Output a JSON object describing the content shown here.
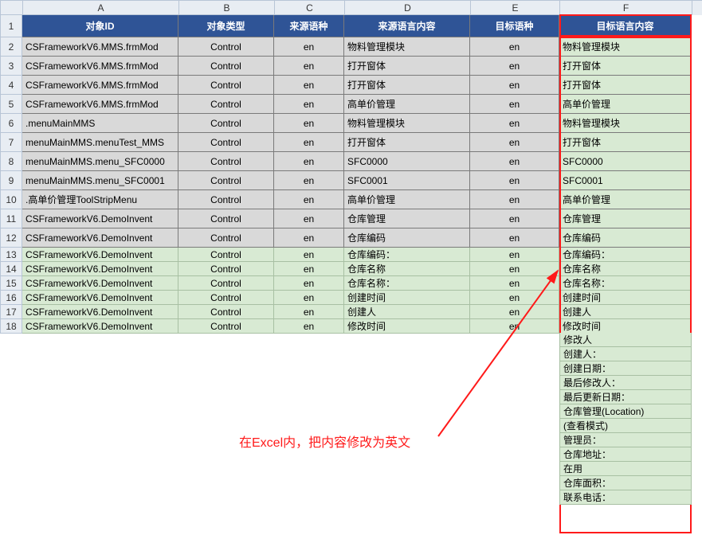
{
  "columnHeaders": {
    "A": "A",
    "B": "B",
    "C": "C",
    "D": "D",
    "E": "E",
    "F": "F"
  },
  "fieldHeaders": {
    "A": "对象ID",
    "B": "对象类型",
    "C": "来源语种",
    "D": "来源语言内容",
    "E": "目标语种",
    "F": "目标语言内容"
  },
  "rows": [
    {
      "num": "1"
    },
    {
      "num": "2",
      "A": "CSFrameworkV6.MMS.frmMod",
      "B": "Control",
      "C": "en",
      "D": "物料管理模块",
      "E": "en",
      "F": "物料管理模块"
    },
    {
      "num": "3",
      "A": "CSFrameworkV6.MMS.frmMod",
      "B": "Control",
      "C": "en",
      "D": "打开窗体",
      "E": "en",
      "F": "打开窗体"
    },
    {
      "num": "4",
      "A": "CSFrameworkV6.MMS.frmMod",
      "B": "Control",
      "C": "en",
      "D": "打开窗体",
      "E": "en",
      "F": "打开窗体"
    },
    {
      "num": "5",
      "A": "CSFrameworkV6.MMS.frmMod",
      "B": "Control",
      "C": "en",
      "D": "高单价管理",
      "E": "en",
      "F": "高单价管理"
    },
    {
      "num": "6",
      "A": ".menuMainMMS",
      "B": "Control",
      "C": "en",
      "D": "物料管理模块",
      "E": "en",
      "F": "物料管理模块"
    },
    {
      "num": "7",
      "A": "menuMainMMS.menuTest_MMS",
      "B": "Control",
      "C": "en",
      "D": "打开窗体",
      "E": "en",
      "F": "打开窗体"
    },
    {
      "num": "8",
      "A": "menuMainMMS.menu_SFC0000",
      "B": "Control",
      "C": "en",
      "D": "SFC0000",
      "E": "en",
      "F": "SFC0000"
    },
    {
      "num": "9",
      "A": "menuMainMMS.menu_SFC0001",
      "B": "Control",
      "C": "en",
      "D": "SFC0001",
      "E": "en",
      "F": "SFC0001"
    },
    {
      "num": "10",
      "A": ".高单价管理ToolStripMenu",
      "B": "Control",
      "C": "en",
      "D": "高单价管理",
      "E": "en",
      "F": "高单价管理"
    },
    {
      "num": "11",
      "A": "CSFrameworkV6.DemoInvent",
      "B": "Control",
      "C": "en",
      "D": "仓库管理",
      "E": "en",
      "F": "仓库管理"
    },
    {
      "num": "12",
      "A": "CSFrameworkV6.DemoInvent",
      "B": "Control",
      "C": "en",
      "D": "仓库编码",
      "E": "en",
      "F": "仓库编码"
    },
    {
      "num": "13",
      "A": "CSFrameworkV6.DemoInvent",
      "B": "Control",
      "C": "en",
      "D": "仓库编码：",
      "E": "en",
      "F": "仓库编码："
    },
    {
      "num": "14",
      "A": "CSFrameworkV6.DemoInvent",
      "B": "Control",
      "C": "en",
      "D": "仓库名称",
      "E": "en",
      "F": "仓库名称"
    },
    {
      "num": "15",
      "A": "CSFrameworkV6.DemoInvent",
      "B": "Control",
      "C": "en",
      "D": "仓库名称：",
      "E": "en",
      "F": "仓库名称："
    },
    {
      "num": "16",
      "A": "CSFrameworkV6.DemoInvent",
      "B": "Control",
      "C": "en",
      "D": "创建时间",
      "E": "en",
      "F": "创建时间"
    },
    {
      "num": "17",
      "A": "CSFrameworkV6.DemoInvent",
      "B": "Control",
      "C": "en",
      "D": "创建人",
      "E": "en",
      "F": "创建人"
    },
    {
      "num": "18",
      "A": "CSFrameworkV6.DemoInvent",
      "B": "Control",
      "C": "en",
      "D": "修改时间",
      "E": "en",
      "F": "修改时间"
    }
  ],
  "extraF": [
    "修改人",
    "创建人：",
    "创建日期：",
    "最后修改人：",
    "最后更新日期：",
    "仓库管理(Location)",
    " (查看模式)",
    "管理员：",
    "仓库地址：",
    "在用",
    "仓库面积：",
    "联系电话："
  ],
  "annotation": "在Excel内，把内容修改为英文"
}
